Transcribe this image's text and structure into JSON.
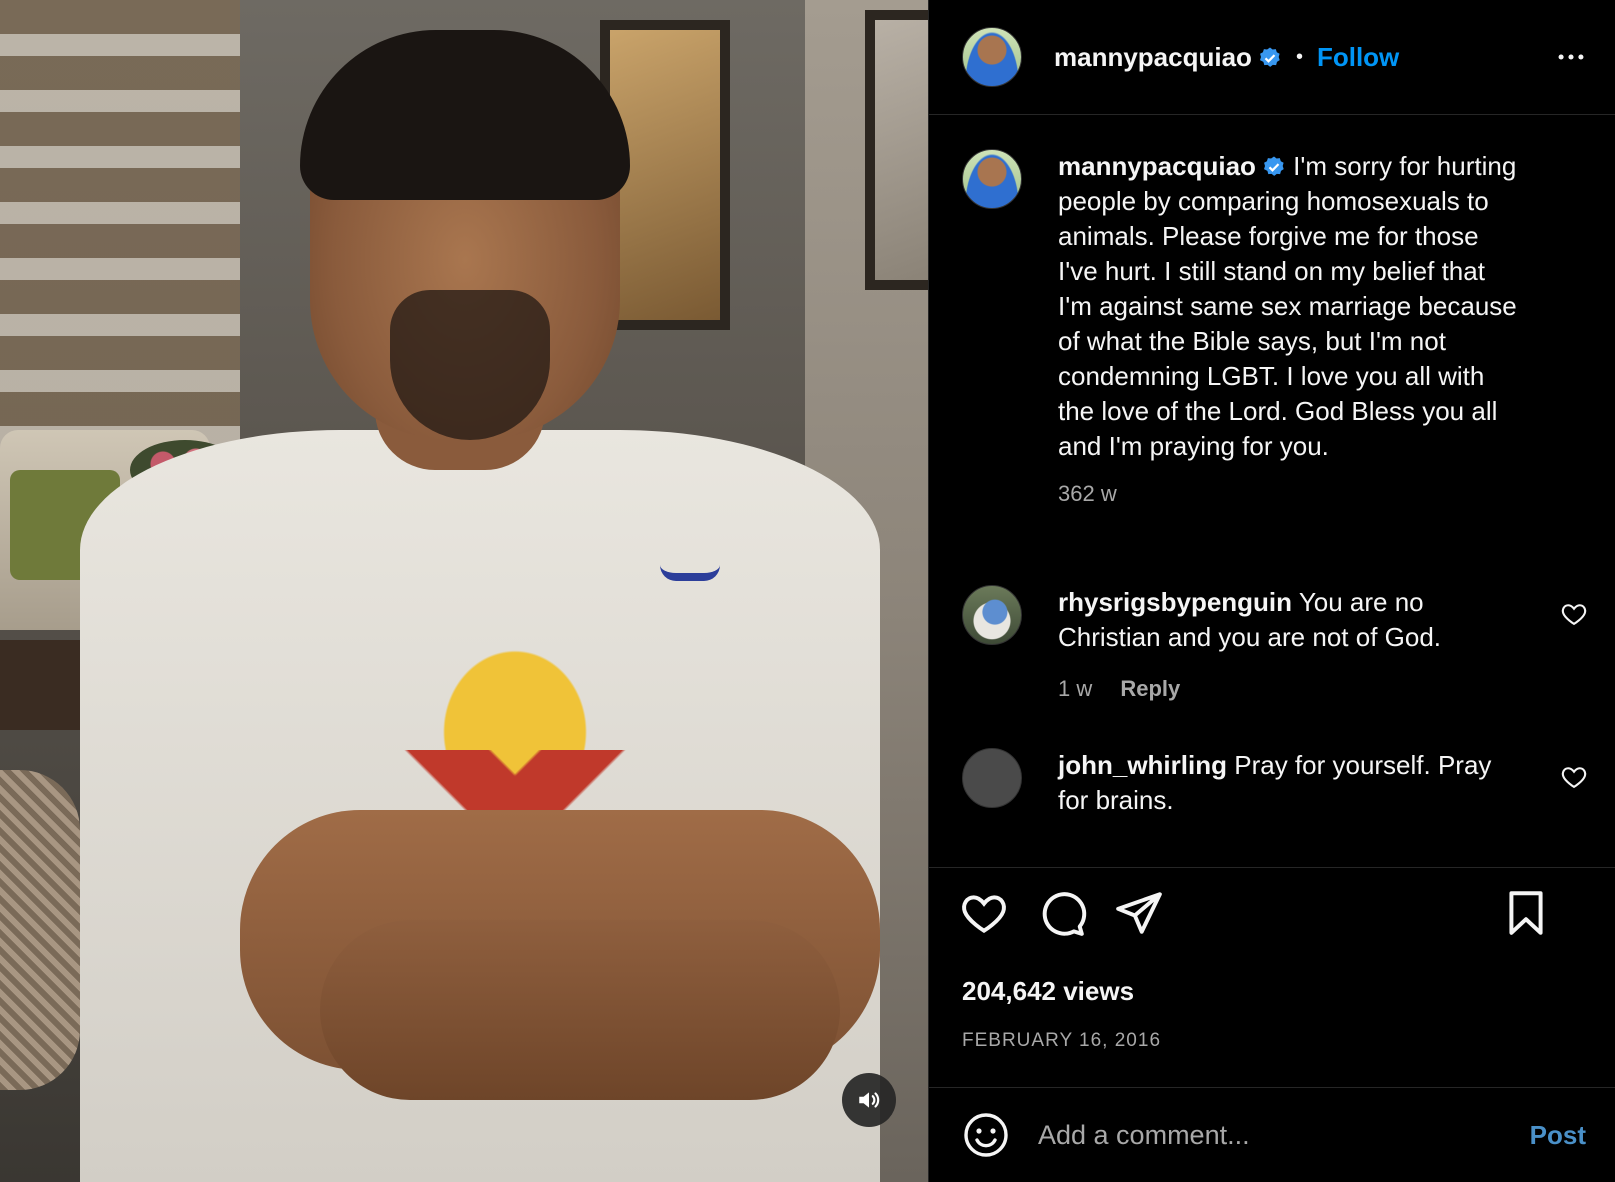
{
  "header": {
    "username": "mannypacquiao",
    "separator": "•",
    "follow_label": "Follow",
    "more_icon": "more-horizontal-icon"
  },
  "post": {
    "caption_user": "mannypacquiao",
    "caption_text": "I'm sorry for hurting people by comparing homosexuals to animals. Please forgive me for those I've hurt. I still stand on my belief that I'm against same sex marriage because of what the Bible says, but I'm not condemning LGBT. I love you all with the love of the Lord. God Bless you all and I'm praying for you.",
    "caption_age": "362 w",
    "views": "204,642 views",
    "date": "FEBRUARY 16, 2016"
  },
  "comments": [
    {
      "user": "rhysrigsbypenguin",
      "text": "You are no Christian and you are not of God.",
      "age": "1 w",
      "reply_label": "Reply"
    },
    {
      "user": "john_whirling",
      "text": "Pray for yourself. Pray for brains."
    }
  ],
  "composer": {
    "placeholder": "Add a comment...",
    "post_label": "Post"
  },
  "colors": {
    "accent": "#0095f6",
    "verified": "#3897f0",
    "background": "#000000",
    "secondary_text": "#a8a8a8"
  },
  "icons": [
    "audio-icon",
    "heart-icon",
    "comment-icon",
    "share-icon",
    "bookmark-icon",
    "emoji-icon",
    "verified-badge-icon"
  ]
}
